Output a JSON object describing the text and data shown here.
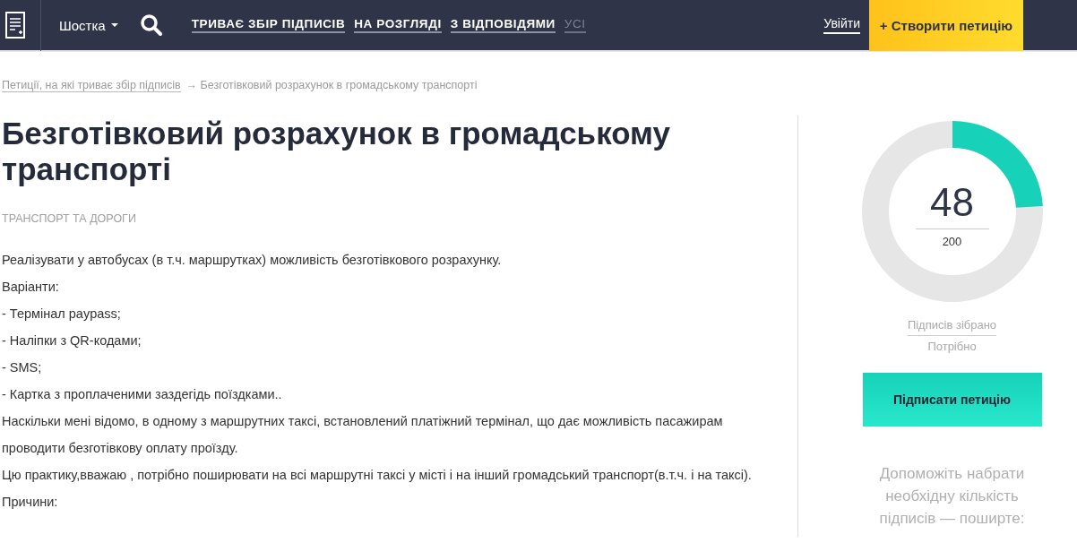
{
  "header": {
    "city": "Шостка",
    "nav": [
      {
        "label": "ТРИВАЄ ЗБІР ПІДПИСІВ",
        "dimmed": false
      },
      {
        "label": "НА РОЗГЛЯДІ",
        "dimmed": false
      },
      {
        "label": "З ВІДПОВІДЯМИ",
        "dimmed": false
      },
      {
        "label": "УСІ",
        "dimmed": true
      }
    ],
    "login": "Увійти",
    "create_button": "+ Створити петицію"
  },
  "breadcrumb": {
    "link": "Петиції, на які триває збір підписів",
    "current": "→ Безготівковий розрахунок в громадському транспорті"
  },
  "petition": {
    "title": "Безготівковий розрахунок в громадському транспорті",
    "category": "ТРАНСПОРТ ТА ДОРОГИ",
    "body": [
      "Реалізувати у автобусах (в т.ч. маршрутках) можливість безготівкового розрахунку.",
      "Варіанти:",
      "- Термінал paypass;",
      "- Наліпки з QR-кодами;",
      "- SMS;",
      "- Картка з проплаченими заздегідь поїздками..",
      "Наскільки мені відомо, в одному з маршрутних таксі, встановлений платіжний термінал, що дає можливість пасажирам проводити безготівкову оплату проїзду.",
      "Цю практику,вважаю , потрібно поширювати на всі маршрутні таксі у місті і на інший громадський транспорт(в.т.ч. і на таксі).",
      "Причини:"
    ]
  },
  "progress": {
    "collected": "48",
    "required": "200",
    "level": 0.24,
    "collected_label": "Підписів зібрано",
    "required_label": "Потрібно",
    "sign_button": "Підписати петицію",
    "share_text": "Допоможіть набрати необхідну кількість підписів — поширте:"
  }
}
